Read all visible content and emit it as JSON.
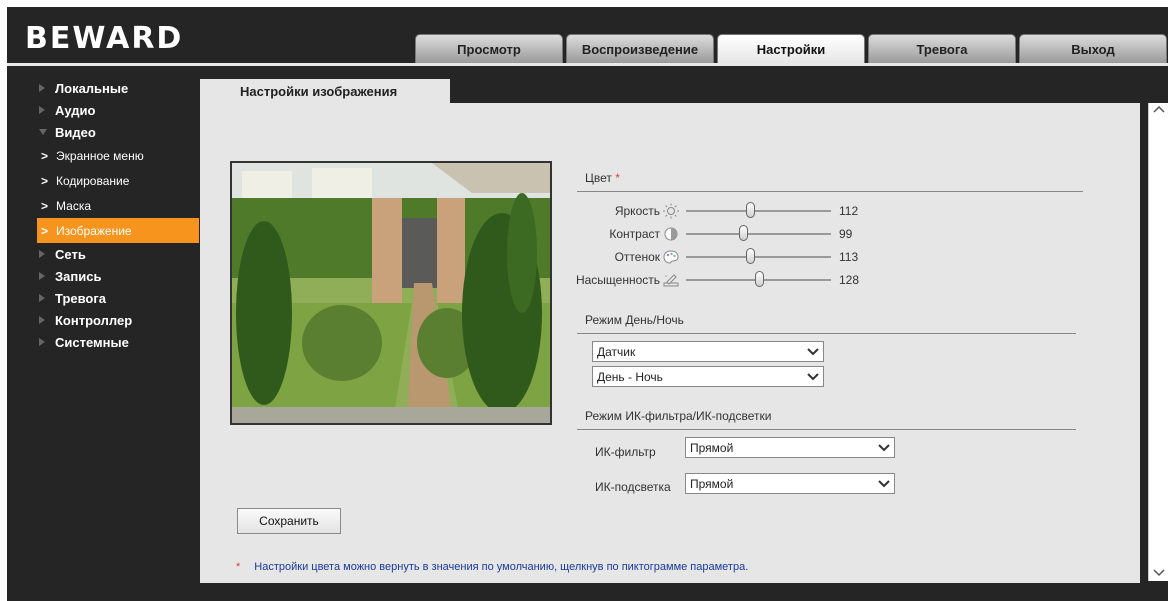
{
  "brand": {
    "logo": "BEWARD"
  },
  "top_tabs": [
    {
      "label": "Просмотр",
      "active": false
    },
    {
      "label": "Воспроизведение",
      "active": false
    },
    {
      "label": "Настройки",
      "active": true
    },
    {
      "label": "Тревога",
      "active": false
    },
    {
      "label": "Выход",
      "active": false
    }
  ],
  "sidebar": {
    "items": [
      {
        "label": "Локальные"
      },
      {
        "label": "Аудио"
      },
      {
        "label": "Видео",
        "expanded": true,
        "children": [
          {
            "label": "Экранное меню"
          },
          {
            "label": "Кодирование"
          },
          {
            "label": "Маска"
          },
          {
            "label": "Изображение",
            "active": true
          }
        ]
      },
      {
        "label": "Сеть"
      },
      {
        "label": "Запись"
      },
      {
        "label": "Тревога"
      },
      {
        "label": "Контроллер"
      },
      {
        "label": "Системные"
      }
    ]
  },
  "page": {
    "tab_title": "Настройки изображения",
    "color_section": {
      "title": "Цвет",
      "star": "*"
    },
    "sliders": [
      {
        "label": "Яркость",
        "icon": "brightness-icon",
        "value": "112",
        "fraction": 0.44
      },
      {
        "label": "Контраст",
        "icon": "contrast-icon",
        "value": "99",
        "fraction": 0.39
      },
      {
        "label": "Оттенок",
        "icon": "hue-icon",
        "value": "113",
        "fraction": 0.44
      },
      {
        "label": "Насыщенность",
        "icon": "saturation-icon",
        "value": "128",
        "fraction": 0.5
      }
    ],
    "daynight_section": {
      "title": "Режим День/Ночь"
    },
    "daynight_selects": [
      "Датчик",
      "День - Ночь"
    ],
    "ir_section": {
      "title": "Режим ИК-фильтра/ИК-подсветки"
    },
    "ir_filter": {
      "label": "ИК-фильтр",
      "value": "Прямой"
    },
    "ir_light": {
      "label": "ИК-подсветка",
      "value": "Прямой"
    },
    "save_label": "Сохранить",
    "note": {
      "star": "*",
      "text": "Настройки цвета можно вернуть в значения по умолчанию, щелкнув по пиктограмме параметра."
    }
  },
  "colors": {
    "accent": "#f7941d",
    "header_bg": "#252525",
    "panel_bg": "#e6e6e6",
    "note_text": "#1a3a9c"
  }
}
